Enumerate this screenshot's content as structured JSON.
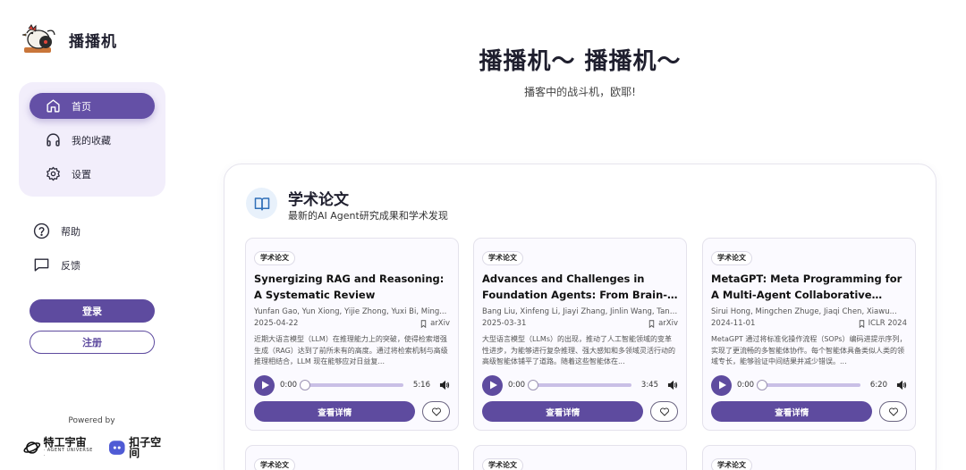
{
  "brand": {
    "name": "播播机",
    "logo_icon": "chicken-logo-icon"
  },
  "nav": {
    "items": [
      {
        "label": "首页",
        "icon": "home-icon",
        "active": true
      },
      {
        "label": "我的收藏",
        "icon": "headphones-icon",
        "active": false
      },
      {
        "label": "设置",
        "icon": "gear-icon",
        "active": false
      }
    ]
  },
  "aux": {
    "help_label": "帮助",
    "feedback_label": "反馈"
  },
  "auth": {
    "login_label": "登录",
    "register_label": "注册"
  },
  "footer": {
    "powered_by": "Powered by",
    "partner1_name": "特工宇宙",
    "partner1_sub": "· AGENT UNIVERSE ·",
    "partner2_name": "扣子空间"
  },
  "hero": {
    "title": "播播机～ 播播机～",
    "subtitle": "播客中的战斗机，欧耶!"
  },
  "section": {
    "title": "学术论文",
    "subtitle": "最新的AI Agent研究成果和学术发现",
    "icon": "book-open-icon"
  },
  "cards": [
    {
      "tag": "学术论文",
      "title": "Synergizing RAG and Reasoning: A Systematic Review",
      "authors": "Yunfan Gao, Yun Xiong, Yijie Zhong, Yuxi Bi, Ming...",
      "date": "2025-04-22",
      "venue": "arXiv",
      "summary": "近期大语言模型（LLM）在推理能力上的突破，使得检索增强生成（RAG）达到了前所未有的高度。通过将检索机制与高级推理相结合，LLM 现在能够应对日益复...",
      "current_time": "0:00",
      "duration": "5:16",
      "progress": 0,
      "detail_label": "查看详情"
    },
    {
      "tag": "学术论文",
      "title": "Advances and Challenges in Foundation Agents: From Brain-Inspired Intelligen...",
      "authors": "Bang Liu, Xinfeng Li, Jiayi Zhang, Jinlin Wang, Tanj...",
      "date": "2025-03-31",
      "venue": "arXiv",
      "summary": "大型语言模型（LLMs）的出现，推动了人工智能领域的变革性进步，为能够进行复杂推理、强大感知和多领域灵活行动的高级智能体铺平了道路。随着这些智能体在...",
      "current_time": "0:00",
      "duration": "3:45",
      "progress": 0,
      "detail_label": "查看详情"
    },
    {
      "tag": "学术论文",
      "title": "MetaGPT: Meta Programming for A Multi-Agent Collaborative Framework",
      "authors": "Sirui Hong, Mingchen Zhuge, Jiaqi Chen, Xiawu...",
      "date": "2024-11-01",
      "venue": "ICLR 2024",
      "summary": "MetaGPT 通过将标准化操作流程（SOPs）编码进提示序列，实现了更流畅的多智能体协作。每个智能体具备类似人类的领域专长，能够验证中间结果并减少错误。...",
      "current_time": "0:00",
      "duration": "6:20",
      "progress": 0,
      "detail_label": "查看详情"
    }
  ],
  "next_row_tags": [
    "学术论文",
    "学术论文",
    "学术论文"
  ],
  "colors": {
    "accent": "#5e4b9f",
    "nav_bg": "#f2eefb",
    "card_bg": "#fbfaff",
    "section_icon_bg": "#e8f1fb"
  }
}
